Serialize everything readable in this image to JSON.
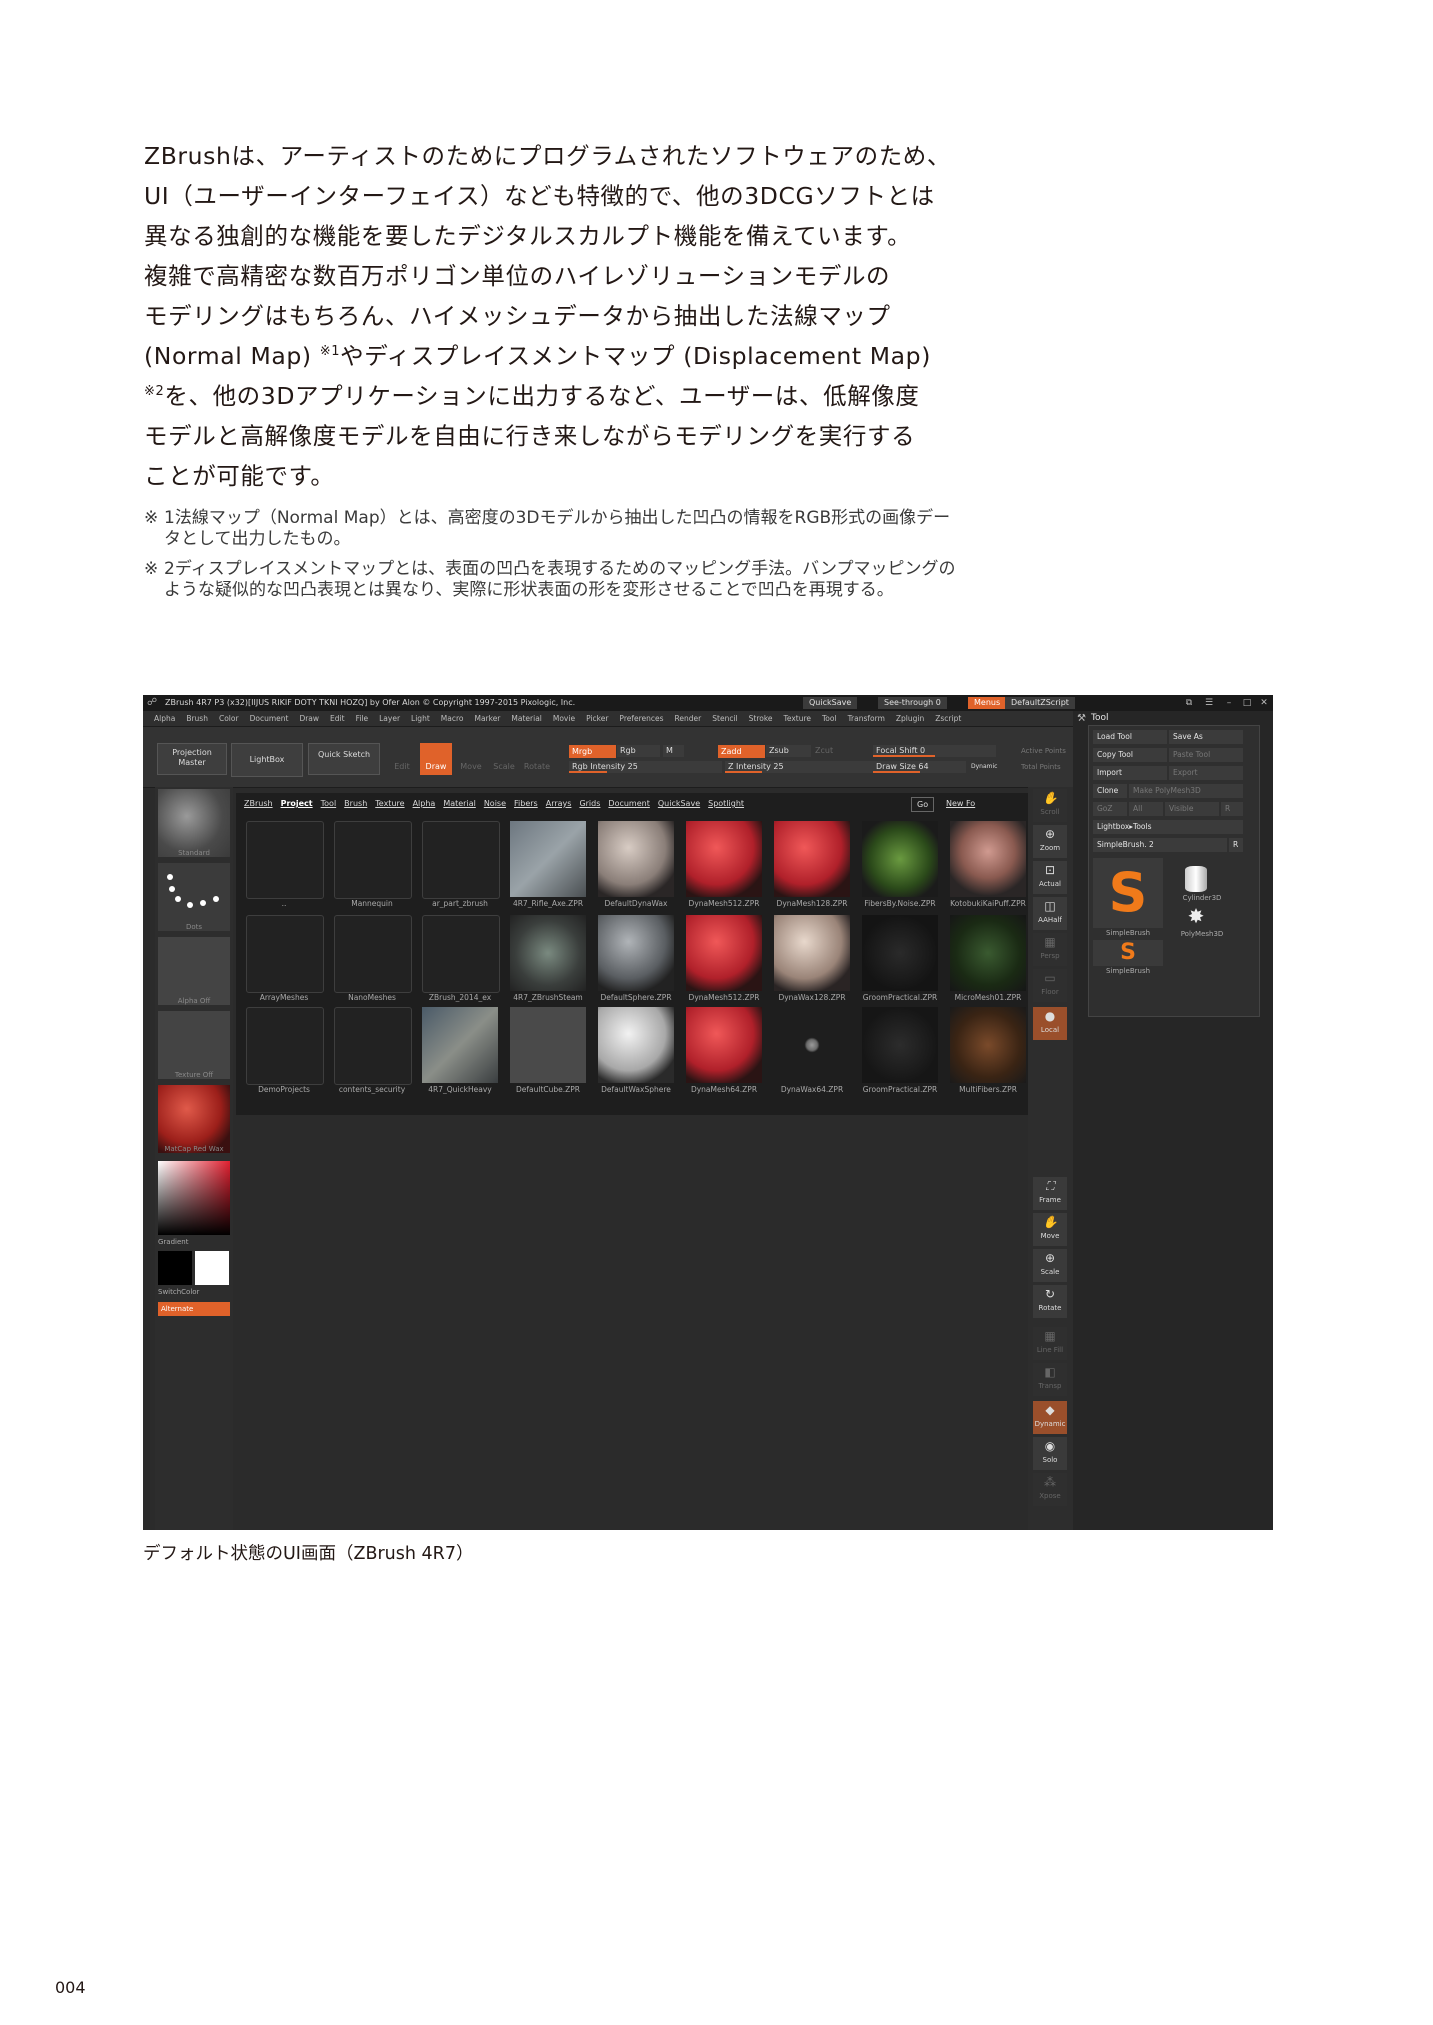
{
  "article": {
    "paragraph_lines": [
      "ZBrushは、アーティストのためにプログラムされたソフトウェアのため、",
      "UI（ユーザーインターフェイス）なども特徴的で、他の3DCGソフトとは",
      "異なる独創的な機能を要したデジタルスカルプト機能を備えています。",
      "複雑で高精密な数百万ポリゴン単位のハイレゾリューションモデルの",
      "モデリングはもちろん、ハイメッシュデータから抽出した法線マップ",
      "(Normal Map)",
      "やディスプレイスメントマップ (Displacement Map)",
      "を、他の3Dアプリケーションに出力するなど、ユーザーは、低解像度",
      "モデルと高解像度モデルを自由に行き来しながらモデリングを実行する",
      "ことが可能です。"
    ],
    "ref1": "※1",
    "ref2": "※2",
    "footnotes": [
      {
        "mark": "※",
        "text": "1法線マップ（Normal Map）とは、高密度の3Dモデルから抽出した凹凸の情報をRGB形式の画像データとして出力したもの。"
      },
      {
        "mark": "※",
        "text": "2ディスプレイスメントマップとは、表面の凹凸を表現するためのマッピング手法。バンプマッピングのような疑似的な凹凸表現とは異なり、実際に形状表面の形を変形させることで凹凸を再現する。"
      }
    ],
    "caption": "デフォルト状態のUI画面（ZBrush 4R7）",
    "page_number": "004"
  },
  "zbrush": {
    "title": "ZBrush 4R7 P3 (x32)[IIJUS RIKIF DOTY TKNI HOZQ] by Ofer Alon © Copyright 1997-2015 Pixologic, Inc.",
    "quicksave": "QuickSave",
    "see_through": "See-through 0",
    "menus": "Menus",
    "default_zscript": "DefaultZScript",
    "menu_items": [
      "Alpha",
      "Brush",
      "Color",
      "Document",
      "Draw",
      "Edit",
      "File",
      "Layer",
      "Light",
      "Macro",
      "Marker",
      "Material",
      "Movie",
      "Picker",
      "Preferences",
      "Render",
      "Stencil",
      "Stroke",
      "Texture",
      "Tool",
      "Transform",
      "Zplugin",
      "Zscript"
    ],
    "toolbar": {
      "projection_master": "Projection Master",
      "lightbox": "LightBox",
      "quick_sketch": "Quick Sketch",
      "edit": "Edit",
      "draw": "Draw",
      "move": "Move",
      "scale": "Scale",
      "rotate": "Rotate",
      "mrgb": "Mrgb",
      "rgb": "Rgb",
      "m": "M",
      "zadd": "Zadd",
      "zsub": "Zsub",
      "zcut": "Zcut",
      "rgb_intensity": "Rgb Intensity 25",
      "z_intensity": "Z Intensity 25",
      "focal_shift": "Focal Shift 0",
      "draw_size": "Draw Size 64",
      "dynamic": "Dynamic",
      "active_points": "Active Points",
      "total_points": "Total Points",
      "rgb_intensity_level": 0.25,
      "z_intensity_level": 0.25,
      "focal_shift_level": 0.5,
      "draw_size_level": 0.5
    },
    "left_shelf": {
      "material_label": "MatCap Red Wax",
      "gradient": "Gradient",
      "switch_color": "SwitchColor",
      "alternate": "Alternate",
      "labels": [
        "Standard",
        "Dots",
        "Alpha Off",
        "Texture Off"
      ]
    },
    "lightbox": {
      "tabs": [
        "ZBrush",
        "Project",
        "Tool",
        "Brush",
        "Texture",
        "Alpha",
        "Material",
        "Noise",
        "Fibers",
        "Arrays",
        "Grids",
        "Document",
        "QuickSave",
        "Spotlight"
      ],
      "go": "Go",
      "new_folder": "New Fo",
      "rows": [
        [
          "..",
          "Mannequin",
          "ar_part_zbrush",
          "4R7_Rifle_Axe.ZPR",
          "DefaultDynaWax",
          "DynaMesh512.ZPR",
          "DynaMesh128.ZPR",
          "FibersBy.Noise.ZPR",
          "KotobukiKaiPuff.ZPR"
        ],
        [
          "ArrayMeshes",
          "NanoMeshes",
          "ZBrush_2014_ex",
          "4R7_ZBrushSteam",
          "DefaultSphere.ZPR",
          "DynaMesh512.ZPR",
          "DynaWax128.ZPR",
          "GroomPractical.ZPR",
          "MicroMesh01.ZPR"
        ],
        [
          "DemoProjects",
          "contents_security",
          "4R7_QuickHeavy",
          "DefaultCube.ZPR",
          "DefaultWaxSphere",
          "DynaMesh64.ZPR",
          "DynaWax64.ZPR",
          "GroomPractical.ZPR",
          "MultiFibers.ZPR"
        ]
      ]
    },
    "right_shelf": [
      "Scroll",
      "Zoom",
      "Actual",
      "AAHalf",
      "Persp",
      "Floor",
      "Local",
      "Frame",
      "Move",
      "Scale",
      "Rotate",
      "Line Fill",
      "Transp",
      "Dynamic",
      "Solo",
      "Xpose"
    ],
    "tool_panel": {
      "title": "Tool",
      "load_tool": "Load Tool",
      "save_as": "Save As",
      "copy_tool": "Copy Tool",
      "paste_tool": "Paste Tool",
      "import": "Import",
      "export": "Export",
      "clone": "Clone",
      "make_polymesh": "Make PolyMesh3D",
      "goz": "GoZ",
      "all": "All",
      "visible": "Visible",
      "r": "R",
      "lightbox_tools": "Lightbox▸Tools",
      "current_tool": "SimpleBrush. 2",
      "tools": [
        "SimpleBrush",
        "Cylinder3D",
        "PolyMesh3D",
        "SimpleBrush"
      ]
    }
  }
}
